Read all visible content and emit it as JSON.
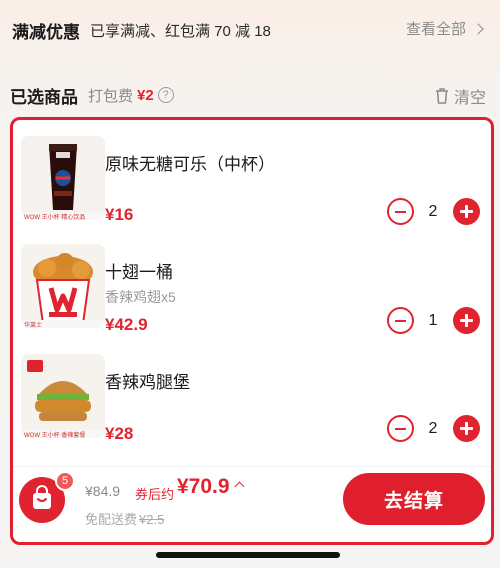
{
  "promo": {
    "title": "满减优惠",
    "description": "已享满减、红包满 70 减 18",
    "view_all": "查看全部"
  },
  "selected": {
    "title": "已选商品",
    "packing_label": "打包费",
    "packing_fee": "¥2",
    "help": "?",
    "clear": "清空"
  },
  "items": [
    {
      "name": "原味无糖可乐（中杯）",
      "subtitle": "",
      "price": "¥16",
      "qty": "2",
      "thumb_tag": "WOW 王小杯 精心饮品"
    },
    {
      "name": "十翅一桶",
      "subtitle": "香辣鸡翅x5",
      "price": "¥42.9",
      "qty": "1",
      "thumb_tag": "华莱士"
    },
    {
      "name": "香辣鸡腿堡",
      "subtitle": "",
      "price": "¥28",
      "qty": "2",
      "thumb_tag": "WOW 王小杯 香辣套餐"
    }
  ],
  "checkout": {
    "badge": "5",
    "original_total": "¥84.9",
    "after_coupon_label": "券后约",
    "final_price": "¥70.9",
    "free_ship": "免配送费",
    "ship_original": "¥2.5",
    "button": "去结算"
  },
  "colors": {
    "accent": "#e0242f"
  }
}
